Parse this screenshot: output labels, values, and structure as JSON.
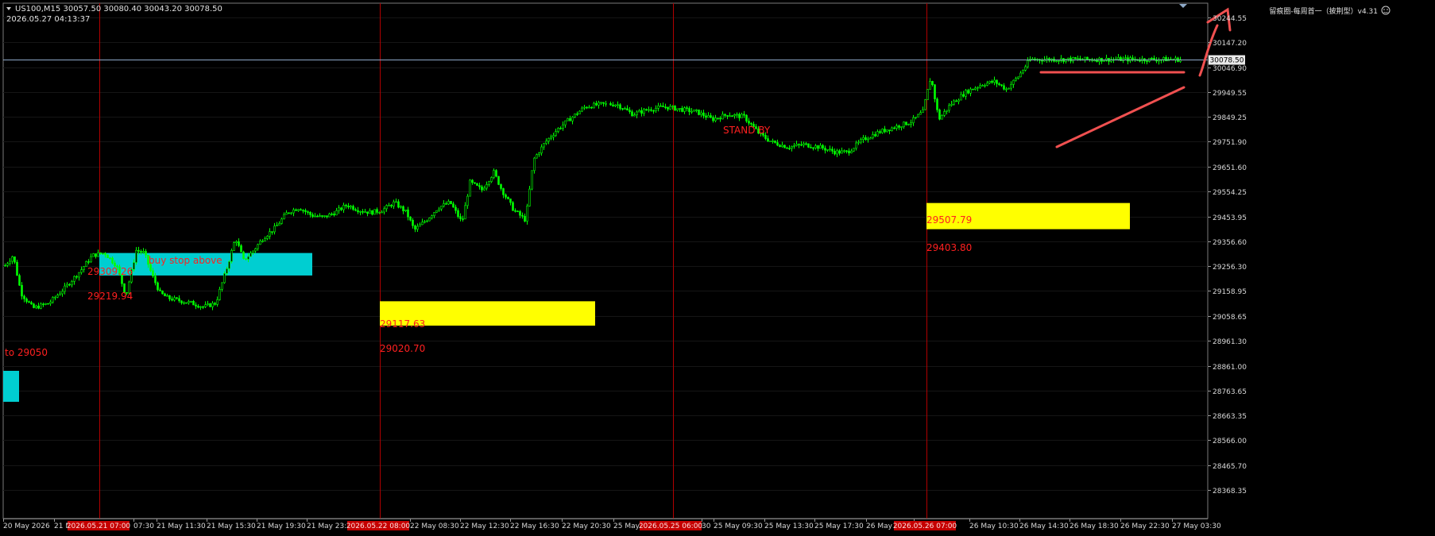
{
  "header": {
    "symbol_line": "US100,M15  30057.50 30080.40 30043.20 30078.50",
    "datetime": "2026.05.27 04:13:37",
    "indicator_label": "留痕圈-每周首一（披荆型）v4.31"
  },
  "price_axis": {
    "ticks": [
      "30244.55",
      "30147.20",
      "30046.90",
      "29949.55",
      "29849.25",
      "29751.90",
      "29651.60",
      "29554.25",
      "29453.95",
      "29356.60",
      "29256.30",
      "29158.95",
      "29058.65",
      "28961.30",
      "28861.00",
      "28763.65",
      "28663.35",
      "28566.00",
      "28465.70",
      "28368.35"
    ],
    "current_price": "30078.50"
  },
  "time_axis": {
    "labels": [
      "20 May 2026",
      "21 M",
      "07:30",
      "21 May 11:30",
      "21 May 15:30",
      "21 May 19:30",
      "21 May 23:",
      "22 May 08:30",
      "22 May 12:30",
      "22 May 16:30",
      "22 May 20:30",
      "25 May",
      "30",
      "25 May 09:30",
      "25 May 13:30",
      "25 May 17:30",
      "26 May",
      "30",
      "26 May 10:30",
      "26 May 14:30",
      "26 May 18:30",
      "26 May 22:30",
      "27 May 03:30"
    ],
    "highlighted": [
      "2026.05.21 07:00",
      "2026.05.22 08:00",
      "2026.05.25 06:00",
      "2026.05.26 07:00"
    ]
  },
  "annotations": {
    "stand_by": "STAND BY",
    "buy_stop": "buy stop above",
    "target": "to 29050"
  },
  "zones": [
    {
      "kind": "cyan",
      "upper": "29309.26",
      "lower": "29219.94"
    },
    {
      "kind": "yellow",
      "upper": "29117.63",
      "lower": "29020.70"
    },
    {
      "kind": "yellow",
      "upper": "29507.79",
      "lower": "29403.80"
    },
    {
      "kind": "cyan",
      "upper": "",
      "lower": ""
    }
  ],
  "colors": {
    "background": "#000000",
    "candle": "#00ff00",
    "grid": "#1f1f1f",
    "session_line": "#c00000",
    "annotation": "#ff2020",
    "cyan_zone": "#00ced1",
    "yellow_zone": "#ffff00",
    "price_line": "#8ea9c8",
    "marker_pen": "#f05050"
  },
  "chart_data": {
    "type": "line",
    "title": "US100,M15",
    "xlabel": "",
    "ylabel": "",
    "ylim": [
      28320,
      30300
    ],
    "grid": true,
    "series": [
      {
        "name": "",
        "x": [
          0,
          10,
          20,
          35,
          55,
          75,
          95,
          110,
          125,
          140,
          152,
          165,
          175,
          185,
          195,
          205,
          220,
          235,
          250,
          265,
          280,
          290,
          300,
          310,
          325,
          340,
          355,
          370,
          385,
          400,
          415,
          430,
          445,
          460,
          475,
          490,
          505,
          515,
          530,
          545,
          560,
          575,
          585,
          600,
          615,
          625,
          640,
          655,
          665,
          680,
          695,
          710,
          730,
          750,
          770,
          790,
          810,
          830,
          850,
          870,
          890,
          910,
          930,
          950,
          965,
          985,
          1005,
          1025,
          1045,
          1060,
          1080,
          1100,
          1120,
          1140,
          1155,
          1165,
          1175,
          1190,
          1210,
          1230,
          1245,
          1260,
          1275,
          1290
        ],
        "y": [
          29260,
          29300,
          29150,
          29090,
          29110,
          29170,
          29240,
          29300,
          29310,
          29260,
          29140,
          29320,
          29310,
          29220,
          29150,
          29130,
          29120,
          29110,
          29095,
          29110,
          29260,
          29370,
          29280,
          29310,
          29370,
          29410,
          29470,
          29490,
          29460,
          29450,
          29470,
          29500,
          29480,
          29470,
          29480,
          29510,
          29470,
          29400,
          29440,
          29490,
          29510,
          29430,
          29590,
          29560,
          29630,
          29560,
          29480,
          29440,
          29680,
          29750,
          29800,
          29840,
          29890,
          29900,
          29900,
          29860,
          29880,
          29890,
          29880,
          29870,
          29840,
          29860,
          29850,
          29780,
          29750,
          29730,
          29740,
          29730,
          29710,
          29710,
          29760,
          29790,
          29810,
          29830,
          29870,
          30010,
          29840,
          29900,
          29950,
          29980,
          29990,
          29960,
          30010,
          30078
        ]
      }
    ]
  }
}
